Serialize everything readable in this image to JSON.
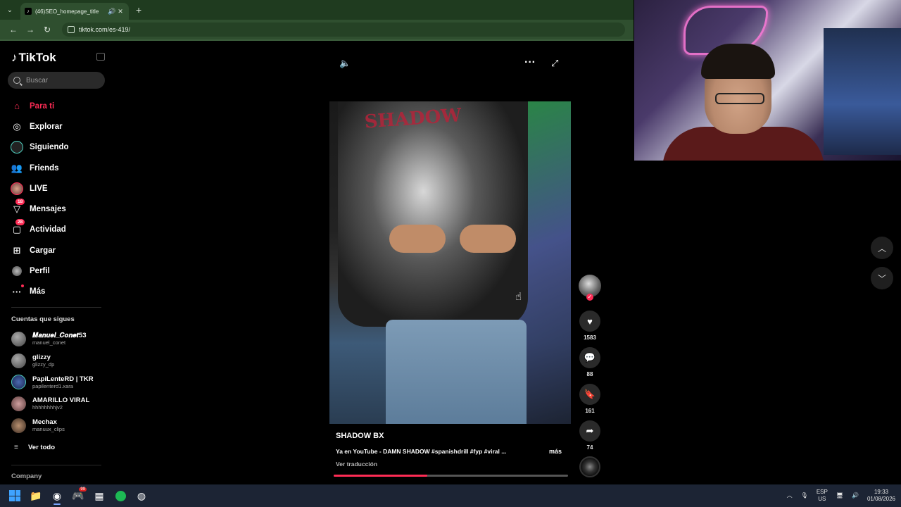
{
  "browser": {
    "tab_title": "(46)SEO_homepage_title",
    "url": "tiktok.com/es-419/",
    "new_tab": "+"
  },
  "sidebar": {
    "brand": "TikTok",
    "search_placeholder": "Buscar",
    "nav": [
      {
        "label": "Para ti",
        "icon": "home-icon",
        "active": true
      },
      {
        "label": "Explorar",
        "icon": "compass-icon"
      },
      {
        "label": "Siguiendo",
        "icon": "following-icon"
      },
      {
        "label": "Friends",
        "icon": "friends-icon"
      },
      {
        "label": "LIVE",
        "icon": "live-icon"
      },
      {
        "label": "Mensajes",
        "icon": "messages-icon",
        "badge": "18"
      },
      {
        "label": "Actividad",
        "icon": "activity-icon",
        "badge": "28"
      },
      {
        "label": "Cargar",
        "icon": "upload-icon"
      },
      {
        "label": "Perfil",
        "icon": "profile-icon"
      },
      {
        "label": "Más",
        "icon": "more-icon"
      }
    ],
    "following_header": "Cuentas que sigues",
    "following": [
      {
        "name": "𝑴𝒂𝒏𝒖𝒆𝒍_𝑪𝒐𝒏𝒆𝒕53",
        "handle": "manuel_conet"
      },
      {
        "name": "glizzy",
        "handle": "glizzy_dp"
      },
      {
        "name": "PapiLenteRD | TKR",
        "handle": "papilenterd1.xara"
      },
      {
        "name": "AMARILLO VIRAL",
        "handle": "hhhhhhhhjv2"
      },
      {
        "name": "Mechax",
        "handle": "manuux_clips"
      }
    ],
    "see_all": "Ver todo",
    "company": "Company"
  },
  "video": {
    "print_text": "SHADOW",
    "author": "SHADOW BX",
    "caption": "Ya en YouTube - DAMN SHADOW #spanishdrill #fyp #viral ...",
    "more": "más",
    "translate": "Ver traducción",
    "progress_fraction": 0.4
  },
  "actions": {
    "likes": "1583",
    "comments": "88",
    "saves": "161",
    "shares": "74"
  },
  "taskbar": {
    "discord_badge": "99",
    "lang": "ESP",
    "region": "US",
    "time": "19:33",
    "date": "01/08/2026"
  },
  "colors": {
    "accent": "#fe2c55",
    "chrome": "#2f4f2f",
    "taskbar": "#1c2434"
  }
}
